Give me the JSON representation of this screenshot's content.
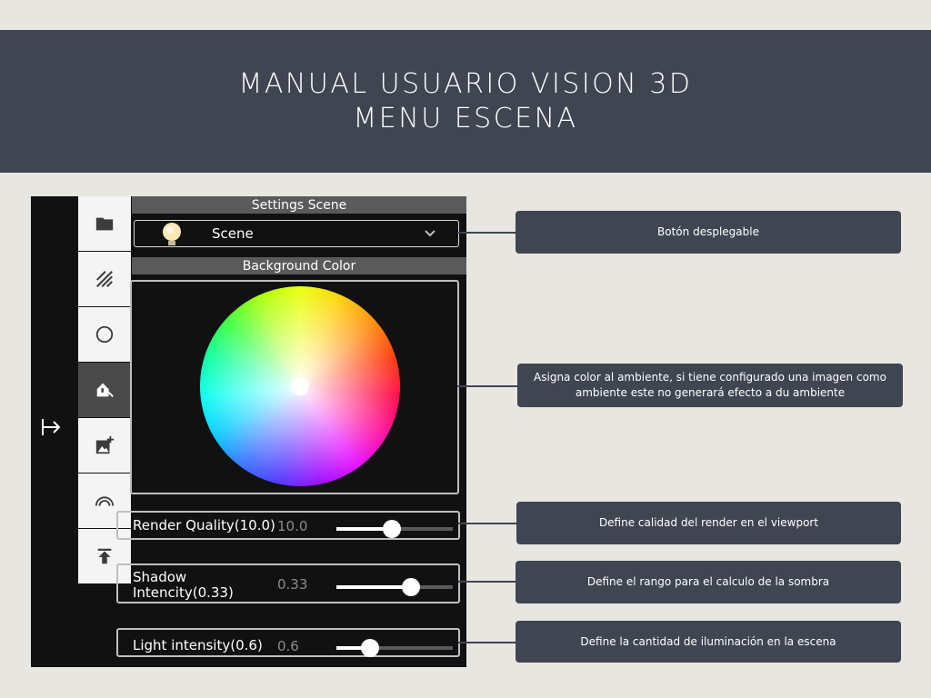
{
  "banner": {
    "title_line1": "MANUAL USUARIO VISION 3D",
    "title_line2": "MENU ESCENA"
  },
  "app": {
    "toolbar": {
      "items": [
        {
          "icon": "folder-icon"
        },
        {
          "icon": "hatch-pattern-icon"
        },
        {
          "icon": "circle-icon"
        },
        {
          "icon": "home-light-icon",
          "active": true
        },
        {
          "icon": "add-image-icon"
        },
        {
          "icon": "rainbow-icon"
        },
        {
          "icon": "upload-icon"
        }
      ],
      "exit_icon": "exit-arrow-icon"
    },
    "settings_scene": {
      "header": "Settings Scene",
      "dropdown_value": "Scene",
      "dropdown_icon": "light-bulb-icon"
    },
    "background_color": {
      "header": "Background Color"
    },
    "sliders": [
      {
        "label": "Render Quality(10.0)",
        "value": "10.0",
        "fraction": 0.48
      },
      {
        "label": "Shadow Intencity(0.33)",
        "value": "0.33",
        "fraction": 0.64
      },
      {
        "label": "Light intensity(0.6)",
        "value": "0.6",
        "fraction": 0.29
      }
    ]
  },
  "callouts": [
    {
      "text": "Botón desplegable"
    },
    {
      "text": "Asigna color al ambiente, si tiene configurado una imagen como ambiente este no generará efecto a du ambiente"
    },
    {
      "text": "Define calidad del render en el viewport"
    },
    {
      "text": "Define el rango para el calculo de la sombra"
    },
    {
      "text": "Define la cantidad de iluminación en la escena"
    }
  ],
  "colors": {
    "banner_bg": "#3f4551",
    "page_bg": "#e8e6e1",
    "app_bg": "#111111",
    "callout_bg": "#3f4551"
  }
}
